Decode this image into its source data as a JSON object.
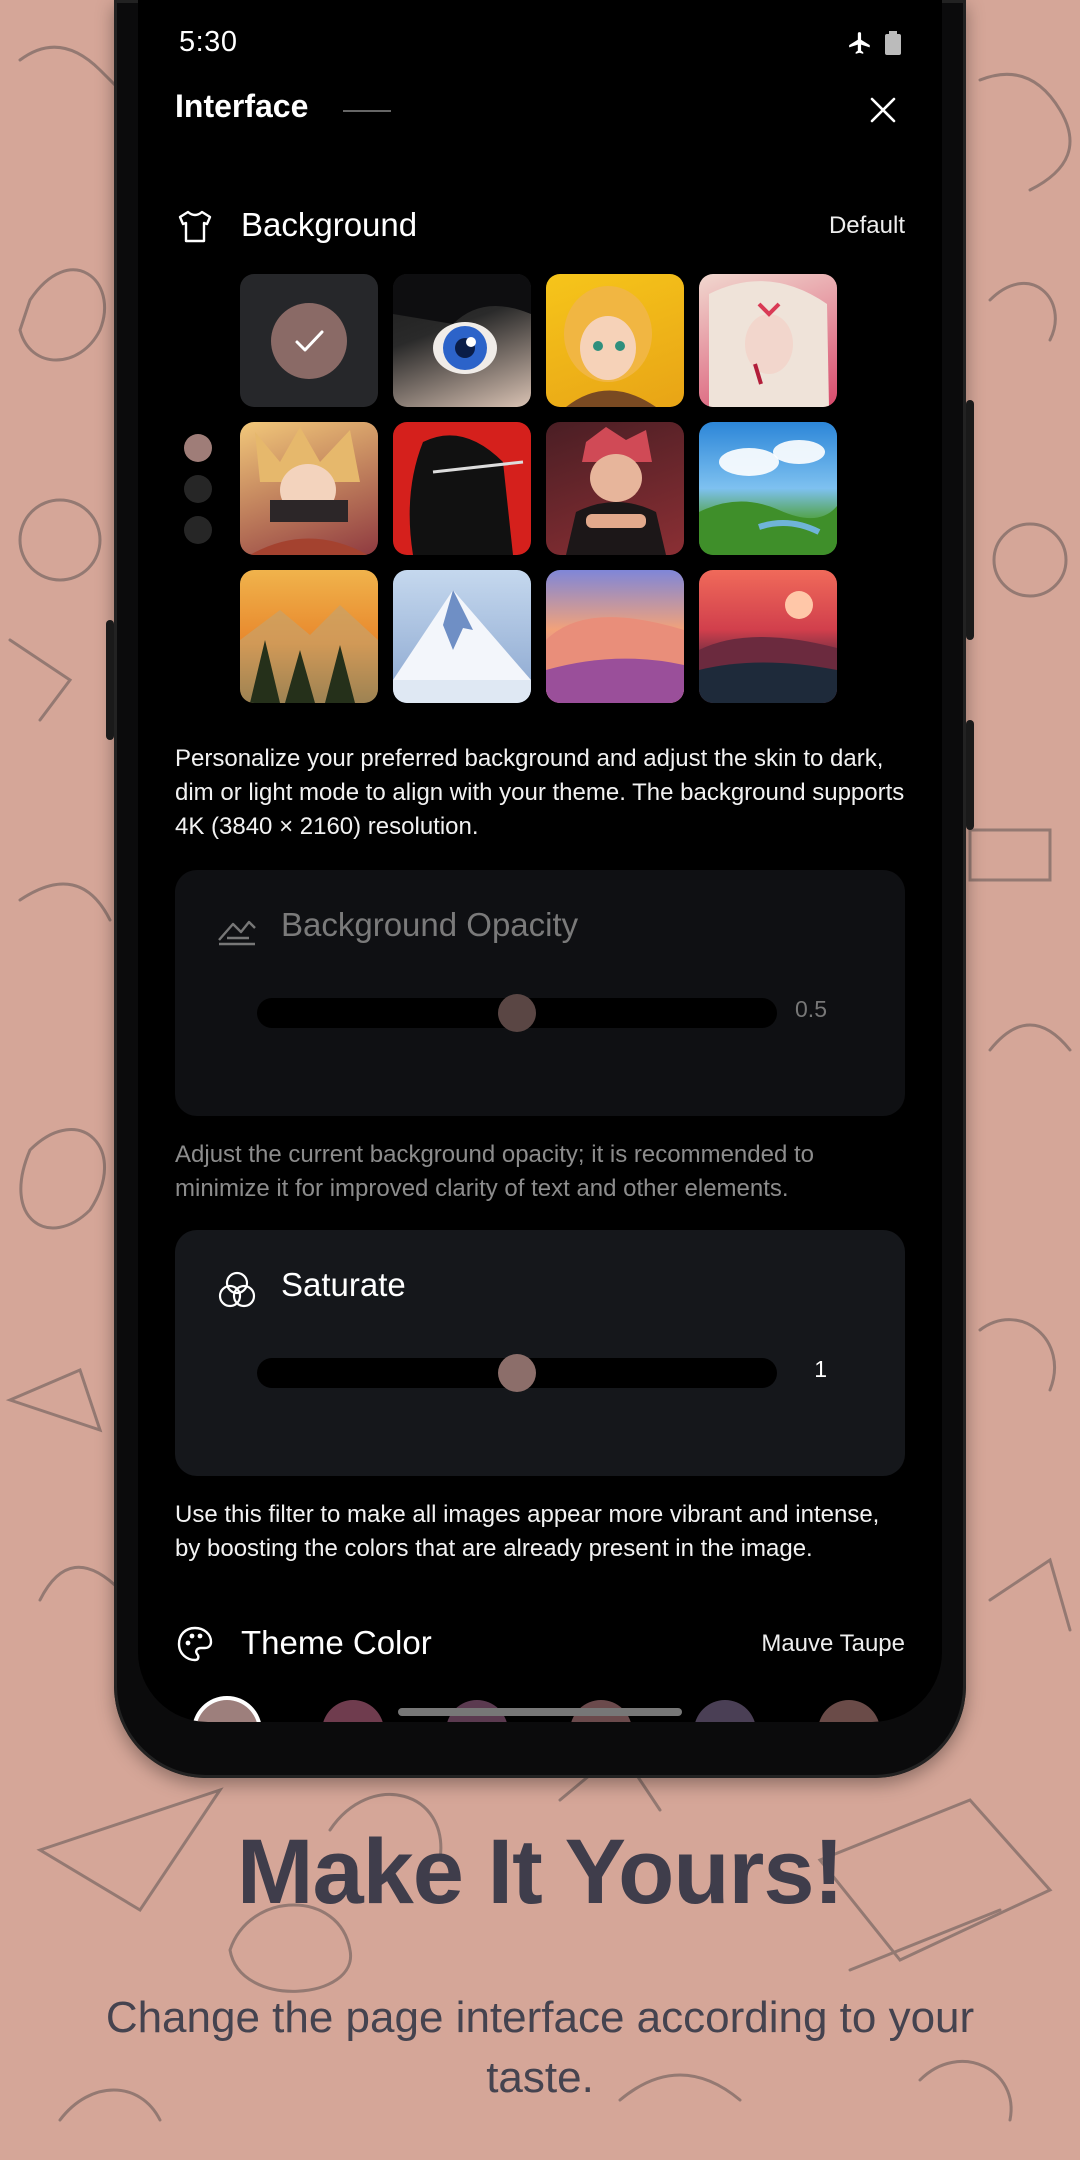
{
  "status_bar": {
    "time": "5:30",
    "icons": [
      "airplane-icon",
      "battery-icon"
    ]
  },
  "header": {
    "title": "Interface",
    "close_icon": "close-icon"
  },
  "background_section": {
    "label": "Background",
    "value": "Default",
    "icon": "tshirt-icon",
    "thumbnails": [
      {
        "name": "default-selected",
        "selected": true
      },
      {
        "name": "anime-blue-eye"
      },
      {
        "name": "anime-blonde-girl"
      },
      {
        "name": "anime-white-hair"
      },
      {
        "name": "anime-pink-hair"
      },
      {
        "name": "anime-red-sword"
      },
      {
        "name": "anime-red-hair-boy"
      },
      {
        "name": "green-landscape"
      },
      {
        "name": "autumn-forest"
      },
      {
        "name": "snowy-mountain"
      },
      {
        "name": "pink-desert"
      },
      {
        "name": "red-sunset"
      }
    ],
    "pages": 3,
    "active_page": 1,
    "description": "Personalize your preferred background and adjust the skin to dark, dim or light mode to align with your theme. The background supports 4K (3840 × 2160) resolution."
  },
  "opacity": {
    "label": "Background Opacity",
    "value_text": "0.5",
    "level": 0.5,
    "description": "Adjust the current background opacity; it is recommended to minimize it for improved clarity of text and other elements."
  },
  "saturate": {
    "label": "Saturate",
    "value_text": "1",
    "level": 0.5,
    "description": "Use this filter to make all images appear more vibrant and intense, by boosting the colors that are already present in the image."
  },
  "theme_color": {
    "label": "Theme Color",
    "value": "Mauve Taupe",
    "icon": "palette-icon",
    "swatches": [
      "#9d7f7c",
      "#6f3c4e",
      "#5b3a50",
      "#6b4a4c",
      "#4a3f55",
      "#6a4b48"
    ]
  },
  "promo": {
    "headline": "Make It Yours!",
    "subtitle": "Change the page interface according to your taste."
  },
  "colors": {
    "accent": "#9f7d78",
    "page_bg": "#d5a698",
    "card_bg": "#15171b"
  }
}
